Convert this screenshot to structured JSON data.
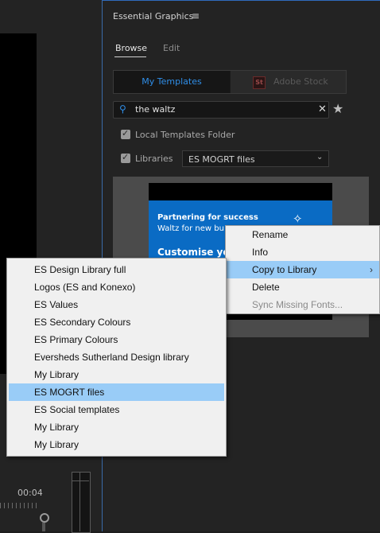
{
  "left": {
    "timecode": "00:04"
  },
  "panel": {
    "title": "Essential Graphics",
    "menu_icon": "≡",
    "tabs": {
      "browse": "Browse",
      "edit": "Edit"
    },
    "segments": {
      "my_templates": "My Templates",
      "adobe_stock": "Adobe Stock",
      "stock_badge": "St"
    },
    "search": {
      "value": "the waltz",
      "clear": "✕"
    },
    "star": "★",
    "local_templates": "Local Templates Folder",
    "libraries": "Libraries",
    "library_select": "ES MOGRT files",
    "thumbnail": {
      "line1": "Partnering for success",
      "line2": "Waltz for new bu",
      "line3": "Customise you"
    }
  },
  "context_menu": {
    "items": [
      "Rename",
      "Info",
      "Copy to Library",
      "Delete",
      "Sync Missing Fonts..."
    ],
    "highlighted": "Copy to Library",
    "disabled": "Sync Missing Fonts...",
    "submenu_arrow": "›"
  },
  "library_submenu": {
    "items": [
      "ES Design Library full",
      "Logos (ES and Konexo)",
      "ES Values",
      "ES Secondary Colours",
      "ES Primary Colours",
      "Eversheds Sutherland Design library",
      "My Library",
      "ES MOGRT files",
      "ES Social templates",
      "My Library",
      "My Library"
    ],
    "highlighted": "ES MOGRT files"
  },
  "colors": {
    "accent": "#2f8ee8",
    "menu_highlight": "#99ccf7",
    "thumb_blue": "#0a6bc4"
  }
}
